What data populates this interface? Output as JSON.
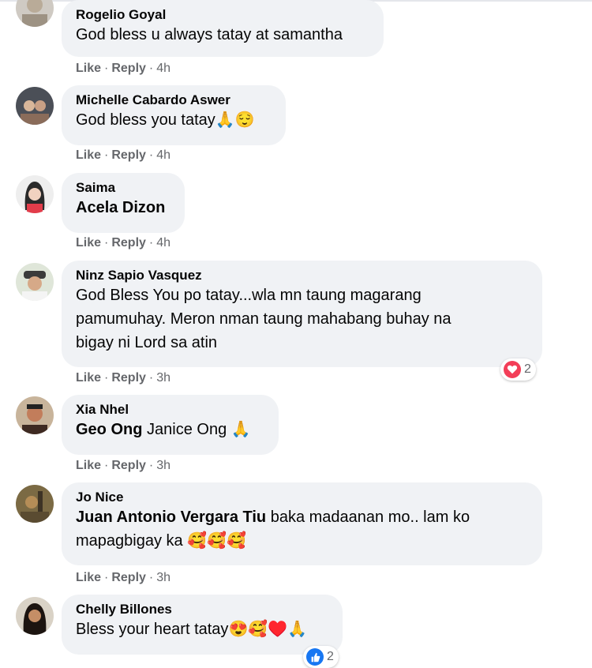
{
  "comments": [
    {
      "author": "Rogelio Goyal",
      "text": "God bless u always tatay at samantha",
      "like": "Like",
      "reply": "Reply",
      "time": "4h"
    },
    {
      "author": "Michelle Cabardo Aswer",
      "text": "God bless you tatay",
      "emojis": "🙏😌",
      "like": "Like",
      "reply": "Reply",
      "time": "4h"
    },
    {
      "author": "Saima",
      "mention": "Acela Dizon",
      "like": "Like",
      "reply": "Reply",
      "time": "4h"
    },
    {
      "author": "Ninz Sapio Vasquez",
      "lines": [
        "God Bless You po tatay...wla mn taung magarang",
        "pamumuhay. Meron nman taung mahabang buhay na",
        "bigay ni Lord sa atin"
      ],
      "like": "Like",
      "reply": "Reply",
      "time": "3h",
      "reaction_count": "2",
      "reaction_icon": "heart-icon",
      "reaction_color": "#f33e58"
    },
    {
      "author": "Xia Nhel",
      "mention": "Geo Ong",
      "text": "Janice Ong",
      "emojis": "🙏",
      "like": "Like",
      "reply": "Reply",
      "time": "3h"
    },
    {
      "author": "Jo Nice",
      "mention": "Juan Antonio Vergara Tiu",
      "text": "baka madaanan mo.. lam ko",
      "text2": "mapagbigay ka",
      "emojis": "🥰🥰🥰",
      "like": "Like",
      "reply": "Reply",
      "time": "3h"
    },
    {
      "author": "Chelly Billones",
      "text": "Bless your heart tatay",
      "emojis": "😍🥰♥️🙏",
      "reaction_count": "2",
      "reaction_icon": "like-icon",
      "reaction_color": "#1877f2"
    }
  ],
  "separator": "·"
}
